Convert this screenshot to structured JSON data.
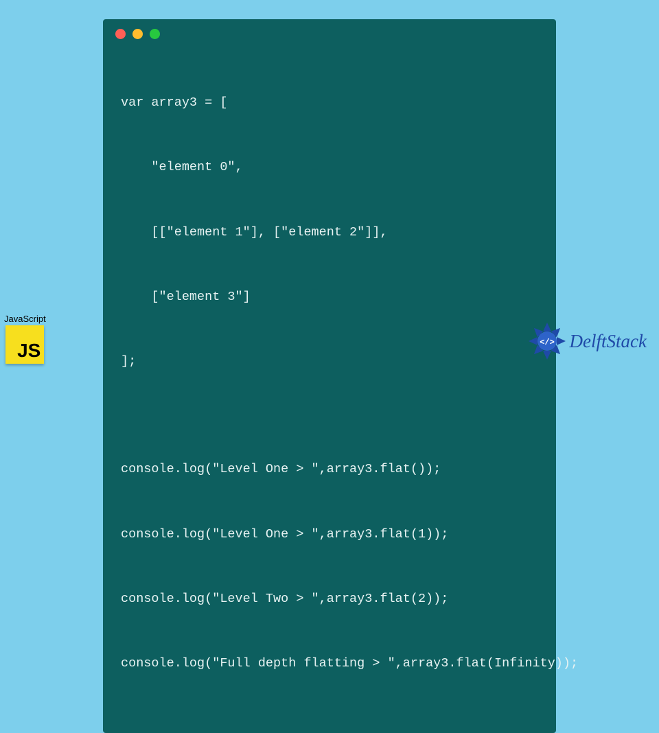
{
  "code": {
    "lines": [
      "var array3 = [",
      "    \"element 0\",",
      "    [[\"element 1\"], [\"element 2\"]],",
      "    [\"element 3\"]",
      "];",
      "",
      "console.log(\"Level One > \",array3.flat());",
      "console.log(\"Level One > \",array3.flat(1));",
      "console.log(\"Level Two > \",array3.flat(2));",
      "console.log(\"Full depth flatting > \",array3.flat(Infinity));"
    ]
  },
  "badges": {
    "js_label": "JavaScript",
    "delft_label": "DelftStack"
  }
}
